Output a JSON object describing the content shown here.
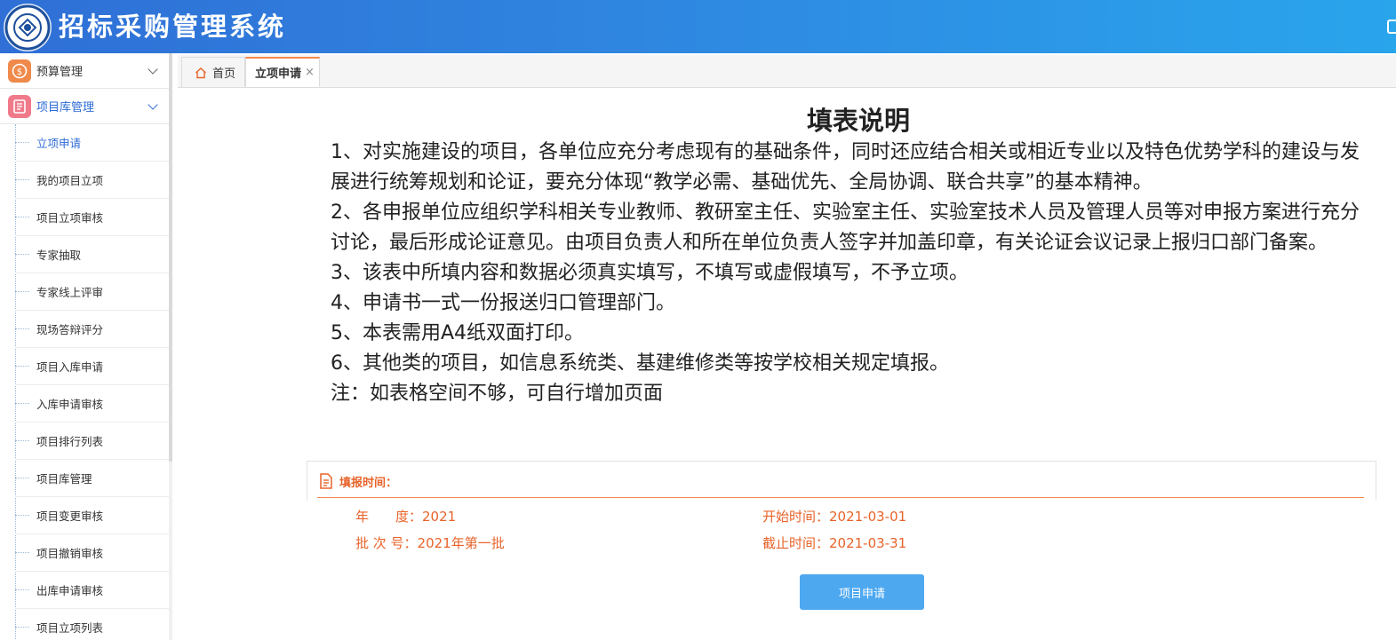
{
  "header": {
    "title": "招标采购管理系统"
  },
  "sidebar": {
    "groups": [
      {
        "label": "预算管理"
      },
      {
        "label": "项目库管理"
      }
    ],
    "items": [
      {
        "label": "立项申请"
      },
      {
        "label": "我的项目立项"
      },
      {
        "label": "项目立项审核"
      },
      {
        "label": "专家抽取"
      },
      {
        "label": "专家线上评审"
      },
      {
        "label": "现场答辩评分"
      },
      {
        "label": "项目入库申请"
      },
      {
        "label": "入库申请审核"
      },
      {
        "label": "项目排行列表"
      },
      {
        "label": "项目库管理"
      },
      {
        "label": "项目变更审核"
      },
      {
        "label": "项目撤销审核"
      },
      {
        "label": "出库申请审核"
      },
      {
        "label": "项目立项列表"
      }
    ]
  },
  "tabs": {
    "home": "首页",
    "active": "立项申请",
    "close_symbol": "×"
  },
  "content": {
    "title": "填表说明",
    "instructions": [
      "1、对实施建设的项目，各单位应充分考虑现有的基础条件，同时还应结合相关或相近专业以及特色优势学科的建设与发展进行统筹规划和论证，要充分体现“教学必需、基础优先、全局协调、联合共享”的基本精神。",
      "2、各申报单位应组织学科相关专业教师、教研室主任、实验室主任、实验室技术人员及管理人员等对申报方案进行充分讨论，最后形成论证意见。由项目负责人和所在单位负责人签字并加盖印章，有关论证会议记录上报归口部门备案。",
      "3、该表中所填内容和数据必须真实填写，不填写或虚假填写，不予立项。",
      "4、申请书一式一份报送归口管理部门。",
      "5、本表需用A4纸双面打印。",
      "6、其他类的项目，如信息系统类、基建维修类等按学校相关规定填报。",
      "注：如表格空间不够，可自行增加页面"
    ],
    "info": {
      "section_title": "填报时间：",
      "year": "年　　度：2021",
      "batch": "批 次 号：2021年第一批",
      "start": "开始时间：2021-03-01",
      "end": "截止时间：2021-03-31"
    },
    "apply_button": "项目申请"
  },
  "colors": {
    "header_start": "#2f6fd6",
    "header_end": "#29a5ec",
    "accent_orange": "#e8632a",
    "link_blue": "#2d6bd6",
    "button_blue": "#4da8f0"
  }
}
